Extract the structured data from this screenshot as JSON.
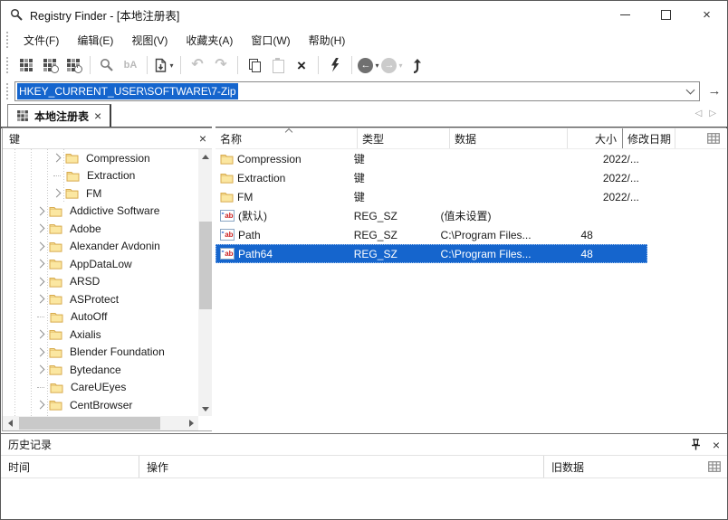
{
  "titlebar": {
    "title": "Registry Finder - [本地注册表]"
  },
  "menu": {
    "items": [
      "文件(F)",
      "编辑(E)",
      "视图(V)",
      "收藏夹(A)",
      "窗口(W)",
      "帮助(H)"
    ]
  },
  "icons": {
    "close": "×",
    "go": "→",
    "dropdown": "▾",
    "undo": "↶",
    "redo": "↷",
    "back": "←",
    "forward": "→",
    "delete": "×",
    "nav_left": "◁",
    "nav_right": "▷",
    "replace": "bA"
  },
  "address": {
    "value": "HKEY_CURRENT_USER\\SOFTWARE\\7-Zip"
  },
  "tabbar": {
    "tab_label": "本地注册表"
  },
  "key_panel": {
    "title": "键",
    "items": [
      {
        "label": "Compression",
        "level": 3,
        "expandable": true
      },
      {
        "label": "Extraction",
        "level": 3,
        "expandable": false
      },
      {
        "label": "FM",
        "level": 3,
        "expandable": true
      },
      {
        "label": "Addictive Software",
        "level": 2,
        "expandable": true
      },
      {
        "label": "Adobe",
        "level": 2,
        "expandable": true
      },
      {
        "label": "Alexander Avdonin",
        "level": 2,
        "expandable": true
      },
      {
        "label": "AppDataLow",
        "level": 2,
        "expandable": true
      },
      {
        "label": "ARSD",
        "level": 2,
        "expandable": true
      },
      {
        "label": "ASProtect",
        "level": 2,
        "expandable": true
      },
      {
        "label": "AutoOff",
        "level": 2,
        "expandable": false
      },
      {
        "label": "Axialis",
        "level": 2,
        "expandable": true
      },
      {
        "label": "Blender Foundation",
        "level": 2,
        "expandable": true
      },
      {
        "label": "Bytedance",
        "level": 2,
        "expandable": true
      },
      {
        "label": "CareUEyes",
        "level": 2,
        "expandable": false
      },
      {
        "label": "CentBrowser",
        "level": 2,
        "expandable": true
      },
      {
        "label": "",
        "level": 2,
        "expandable": true
      }
    ]
  },
  "values_panel": {
    "columns": {
      "name": "名称",
      "type": "类型",
      "data": "数据",
      "size": "大小",
      "modified": "修改日期"
    },
    "rows": [
      {
        "icon": "key",
        "name": "Compression",
        "type": "键",
        "data": "",
        "size": "",
        "modified": "2022/...",
        "selected": false
      },
      {
        "icon": "key",
        "name": "Extraction",
        "type": "键",
        "data": "",
        "size": "",
        "modified": "2022/...",
        "selected": false
      },
      {
        "icon": "key",
        "name": "FM",
        "type": "键",
        "data": "",
        "size": "",
        "modified": "2022/...",
        "selected": false
      },
      {
        "icon": "string",
        "name": "(默认)",
        "type": "REG_SZ",
        "data": "(值未设置)",
        "size": "",
        "modified": "",
        "selected": false
      },
      {
        "icon": "string",
        "name": "Path",
        "type": "REG_SZ",
        "data": "C:\\Program Files...",
        "size": "48",
        "modified": "",
        "selected": false
      },
      {
        "icon": "string",
        "name": "Path64",
        "type": "REG_SZ",
        "data": "C:\\Program Files...",
        "size": "48",
        "modified": "",
        "selected": true
      }
    ]
  },
  "history_panel": {
    "title": "历史记录",
    "columns": {
      "time": "时间",
      "operation": "操作",
      "old_data": "旧数据"
    }
  },
  "colors": {
    "selection": "#1565cd",
    "folder_fill": "#fbe7a1",
    "folder_border": "#d8ab4e"
  }
}
